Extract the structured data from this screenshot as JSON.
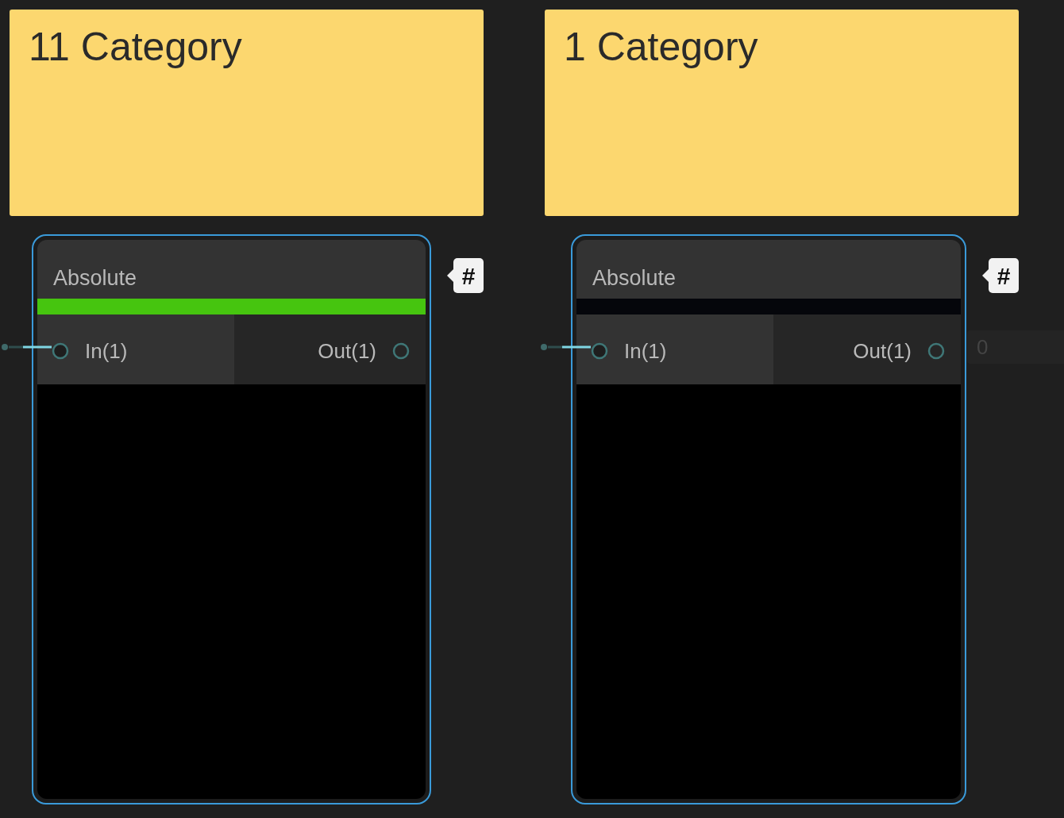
{
  "columns": [
    {
      "note": {
        "title": "11 Category"
      },
      "node": {
        "title": "Absolute",
        "color": "#46c50f",
        "input": {
          "label": "In(1)",
          "connected": true
        },
        "output": {
          "label": "Out(1)"
        },
        "badge": "#"
      }
    },
    {
      "note": {
        "title": "1 Category"
      },
      "node": {
        "title": "Absolute",
        "color": "#05060b",
        "input": {
          "label": "In(1)",
          "connected": true
        },
        "output": {
          "label": "Out(1)",
          "value": "0"
        },
        "badge": "#"
      }
    }
  ]
}
